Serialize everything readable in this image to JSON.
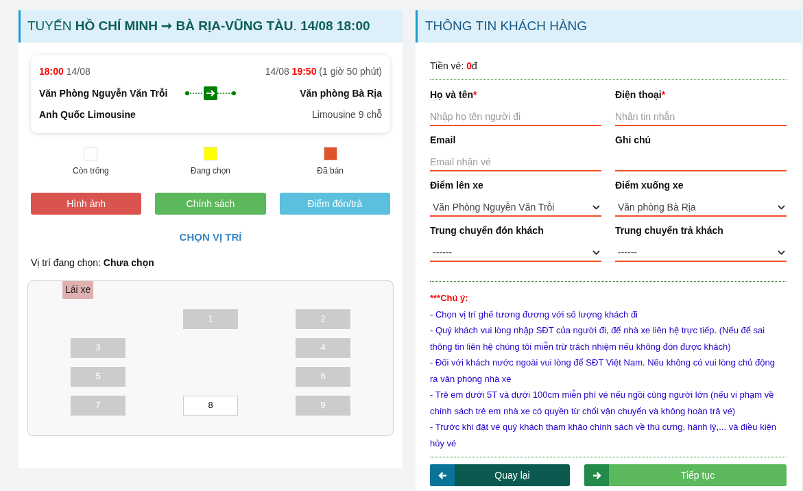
{
  "trip_panel": {
    "title": "TUYẾN **HỒ CHÍ MINH ➞ BÀ RỊA-VŨNG TÀU**. **14/08 18:00**",
    "trip": {
      "depart_time": "18:00",
      "depart_date": "14/08",
      "arrive_date": "14/08",
      "arrive_time": "19:50",
      "duration": "(1 giờ 50 phút)",
      "from": "Văn Phòng Nguyễn Văn Trỗi",
      "to": "Văn phòng Bà Rịa",
      "operator": "Anh Quốc Limousine",
      "vehicle": "Limousine 9 chỗ"
    },
    "legend": [
      {
        "label": "Còn trống",
        "color": "#ffffff"
      },
      {
        "label": "Đang chọn",
        "color": "#ffff00"
      },
      {
        "label": "Đã bán",
        "color": "#e0522b"
      }
    ],
    "buttons": [
      {
        "label": "Hình ảnh",
        "kind": "danger"
      },
      {
        "label": "Chính sách",
        "kind": "success"
      },
      {
        "label": "Điểm đón/trả",
        "kind": "info"
      }
    ],
    "seat_heading": "CHỌN VỊ TRÍ",
    "selection_label": "Vị trí đang chọn:",
    "selection_value": "Chưa chọn",
    "driver_label": "Lái xe",
    "seat_rows": [
      [
        null,
        {
          "label": "1",
          "disabled": true
        },
        {
          "label": "2",
          "disabled": true
        }
      ],
      [
        {
          "label": "3",
          "disabled": true
        },
        null,
        {
          "label": "4",
          "disabled": true
        }
      ],
      [
        {
          "label": "5",
          "disabled": true
        },
        null,
        {
          "label": "6",
          "disabled": true
        }
      ],
      [
        {
          "label": "7",
          "disabled": true
        },
        {
          "label": "8",
          "disabled": false
        },
        {
          "label": "9",
          "disabled": true
        }
      ]
    ]
  },
  "customer_panel": {
    "title": "THÔNG TIN KHÁCH HÀNG",
    "price_label": "Tiền vé:",
    "price_value": "0",
    "price_unit": "đ",
    "fields": [
      {
        "label": "Họ và tên",
        "required_mark": "*",
        "kind": "text",
        "placeholder": "Nhập họ tên người đi"
      },
      {
        "label": "Điện thoại",
        "required_mark": "*",
        "kind": "text",
        "placeholder": "Nhận tin nhắn"
      },
      {
        "label": "Email",
        "kind": "text",
        "placeholder": "Email nhận vé"
      },
      {
        "label": "Ghi chú",
        "kind": "text"
      },
      {
        "label": "Điểm lên xe",
        "kind": "select",
        "value": "Văn Phòng Nguyễn Văn Trỗi"
      },
      {
        "label": "Điểm xuống xe",
        "kind": "select",
        "value": "Văn phòng Bà Rịa"
      },
      {
        "label": "Trung chuyển đón khách",
        "kind": "select",
        "value": "------"
      },
      {
        "label": "Trung chuyển trả khách",
        "kind": "select",
        "value": "------"
      }
    ],
    "notice_title": "***Chú ý:",
    "notices": [
      "- Chọn vị trí ghế tương đương với số lượng khách đi",
      "- Quý khách vui lòng nhập SĐT của người đi, để nhà xe liên hệ trực tiếp. (Nếu để sai thông tin liên hệ chúng tôi miễn trừ trách nhiệm nếu không đón được khách)",
      "- Đối với khách nước ngoài vui lòng để SĐT Việt Nam. Nếu không có vui lòng chủ động ra văn phòng nhà xe",
      "- Trẻ em dưới 5T và dưới 100cm miễn phí vé nếu ngồi cùng người lớn (nếu vi phạm về chính sách trẻ em nhà xe có quyền từ chối vận chuyển và không hoàn trả vé)",
      "- Trước khi đặt vé quý khách tham khảo chính sách về thú cưng, hành lý,... và điều kiện hủy vé"
    ],
    "actions": [
      {
        "label": "Quay lại",
        "kind": "back"
      },
      {
        "label": "Tiếp tục",
        "kind": "next"
      }
    ]
  }
}
